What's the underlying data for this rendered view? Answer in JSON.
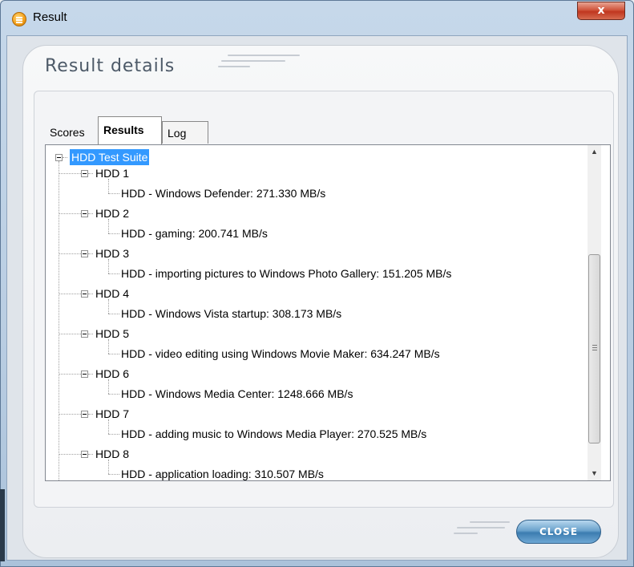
{
  "window": {
    "title": "Result",
    "close_glyph": "x",
    "icon": "app-icon"
  },
  "header": {
    "title": "Result details"
  },
  "tabs": [
    {
      "label": "Scores",
      "active": false
    },
    {
      "label": "Results",
      "active": true
    },
    {
      "label": "Log",
      "active": false
    }
  ],
  "tree": {
    "root": "HDD Test Suite",
    "groups": [
      {
        "label": "HDD 1",
        "child": "HDD - Windows Defender: 271.330 MB/s"
      },
      {
        "label": "HDD 2",
        "child": "HDD - gaming: 200.741 MB/s"
      },
      {
        "label": "HDD 3",
        "child": "HDD - importing pictures to Windows Photo Gallery: 151.205 MB/s"
      },
      {
        "label": "HDD 4",
        "child": "HDD - Windows Vista startup: 308.173 MB/s"
      },
      {
        "label": "HDD 5",
        "child": "HDD - video editing using Windows Movie Maker: 634.247 MB/s"
      },
      {
        "label": "HDD 6",
        "child": "HDD - Windows Media Center: 1248.666 MB/s"
      },
      {
        "label": "HDD 7",
        "child": "HDD - adding music to Windows Media Player: 270.525 MB/s"
      },
      {
        "label": "HDD 8",
        "child": "HDD - application loading: 310.507 MB/s"
      }
    ]
  },
  "footer": {
    "close_label": "CLOSE"
  },
  "colors": {
    "selection": "#3399ff",
    "close_button": "#3b7cb0",
    "title_close": "#c0361f"
  }
}
